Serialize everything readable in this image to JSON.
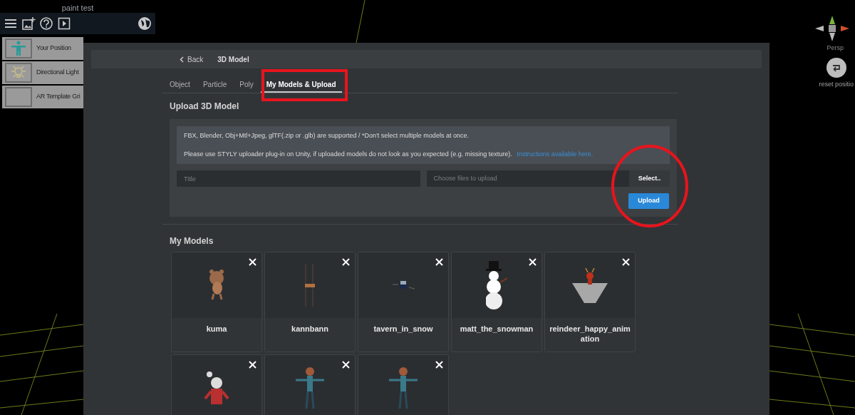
{
  "app": {
    "title": "paint test"
  },
  "scene_items": [
    {
      "label": "Your Position",
      "kind": "person"
    },
    {
      "label": "Directional Light",
      "kind": "light"
    },
    {
      "label": "AR Template Gri",
      "kind": "blank"
    }
  ],
  "view": {
    "mode": "Persp",
    "reset_label": "reset positio"
  },
  "dialog": {
    "back": "Back",
    "title": "3D Model",
    "tabs": [
      {
        "label": "Object",
        "selected": false
      },
      {
        "label": "Particle",
        "selected": false
      },
      {
        "label": "Poly",
        "selected": false
      },
      {
        "label": "My Models & Upload",
        "selected": true
      }
    ],
    "upload": {
      "heading": "Upload 3D Model",
      "note": "FBX, Blender, Obj+Mtl+Jpeg, glTF(.zip or .glb) are supported / *Don't select multiple models at once.",
      "hint": "Please use STYLY uploader plug-in on Unity, if uploaded models do not look as you expected (e.g. missing texture).",
      "link": "Instructions available here.",
      "title_placeholder": "Title",
      "file_placeholder": "Choose files to upload",
      "select_button": "Select..",
      "upload_button": "Upload"
    },
    "models_heading": "My Models",
    "models": [
      {
        "name": "kuma",
        "kind": "bear"
      },
      {
        "name": "kannbann",
        "kind": "sign"
      },
      {
        "name": "tavern_in_snow",
        "kind": "small"
      },
      {
        "name": "matt_the_snowman",
        "kind": "snowman"
      },
      {
        "name": "reindeer_happy_animation",
        "kind": "reindeer"
      },
      {
        "kind": "santa"
      },
      {
        "kind": "figure"
      },
      {
        "kind": "figure"
      }
    ]
  }
}
